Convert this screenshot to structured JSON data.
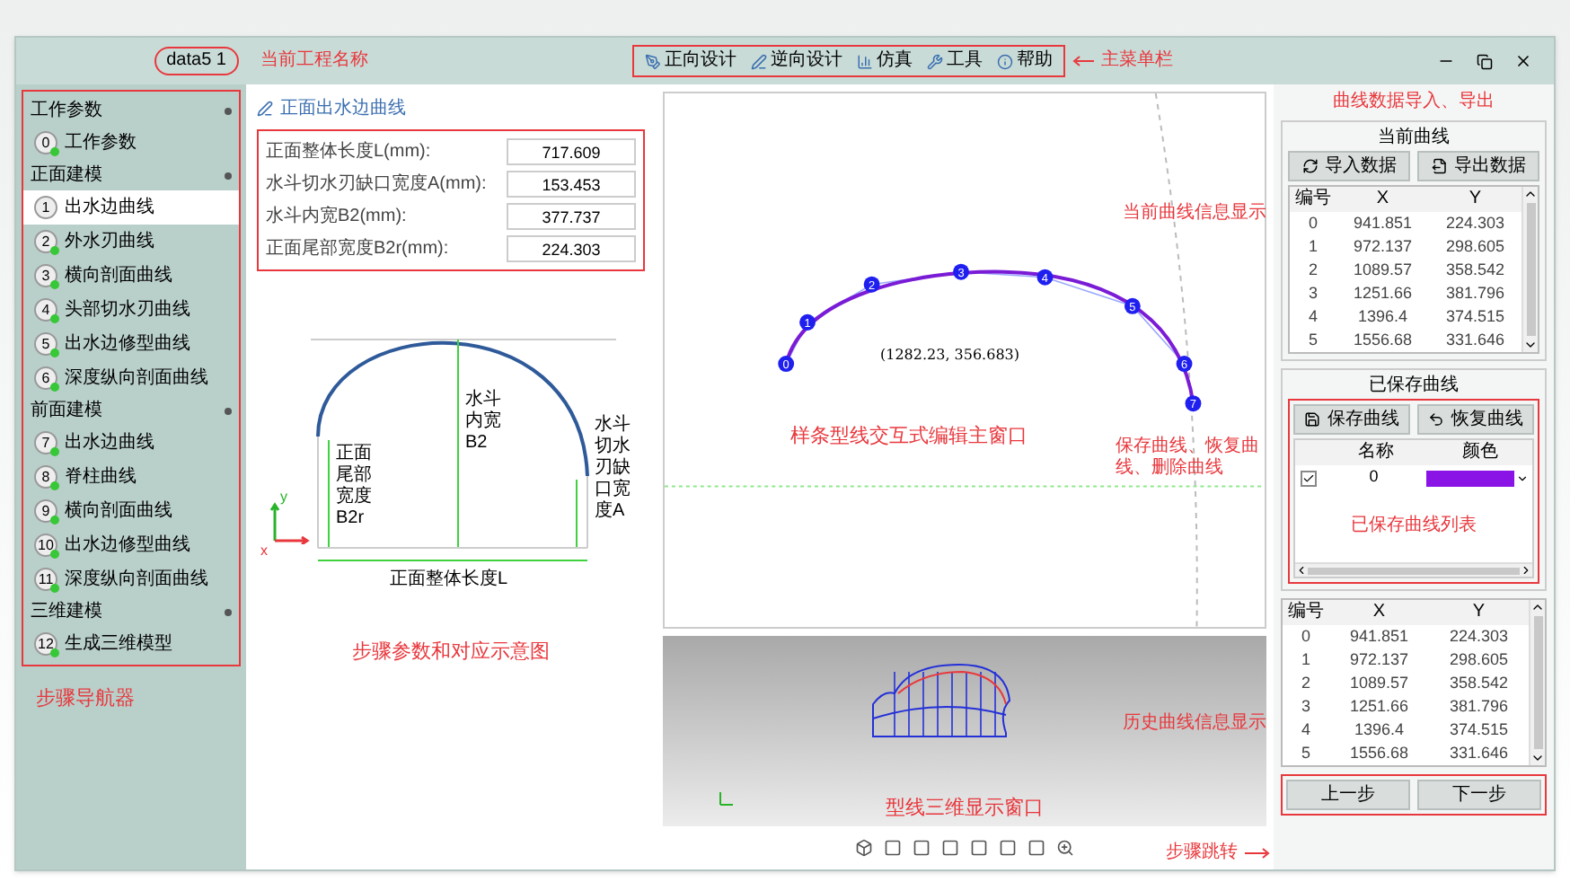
{
  "window": {
    "project_name": "data5 1",
    "project_name_note": "当前工程名称"
  },
  "menu": {
    "items": [
      {
        "label": "正向设计"
      },
      {
        "label": "逆向设计"
      },
      {
        "label": "仿真"
      },
      {
        "label": "工具"
      },
      {
        "label": "帮助"
      }
    ],
    "note": "主菜单栏"
  },
  "navigator": {
    "groups": [
      {
        "title": "工作参数",
        "items": [
          {
            "number": "0",
            "label": "工作参数",
            "selected": false,
            "done": true
          }
        ]
      },
      {
        "title": "正面建模",
        "items": [
          {
            "number": "1",
            "label": "出水边曲线",
            "selected": true,
            "done": false
          },
          {
            "number": "2",
            "label": "外水刃曲线",
            "selected": false,
            "done": true
          },
          {
            "number": "3",
            "label": "横向剖面曲线",
            "selected": false,
            "done": true
          },
          {
            "number": "4",
            "label": "头部切水刃曲线",
            "selected": false,
            "done": true
          },
          {
            "number": "5",
            "label": "出水边修型曲线",
            "selected": false,
            "done": true
          },
          {
            "number": "6",
            "label": "深度纵向剖面曲线",
            "selected": false,
            "done": true
          }
        ]
      },
      {
        "title": "前面建模",
        "items": [
          {
            "number": "7",
            "label": "出水边曲线",
            "selected": false,
            "done": true
          },
          {
            "number": "8",
            "label": "脊柱曲线",
            "selected": false,
            "done": true
          },
          {
            "number": "9",
            "label": "横向剖面曲线",
            "selected": false,
            "done": true
          },
          {
            "number": "10",
            "label": "出水边修型曲线",
            "selected": false,
            "done": true
          },
          {
            "number": "11",
            "label": "深度纵向剖面曲线",
            "selected": false,
            "done": true
          }
        ]
      },
      {
        "title": "三维建模",
        "items": [
          {
            "number": "12",
            "label": "生成三维模型",
            "selected": false,
            "done": true
          }
        ]
      }
    ],
    "note": "步骤导航器"
  },
  "params": {
    "title": "正面出水边曲线",
    "fields": [
      {
        "label": "正面整体长度L(mm):",
        "value": "717.609"
      },
      {
        "label": "水斗切水刃缺口宽度A(mm):",
        "value": "153.453"
      },
      {
        "label": "水斗内宽B2(mm):",
        "value": "377.737"
      },
      {
        "label": "正面尾部宽度B2r(mm):",
        "value": "224.303"
      }
    ],
    "diagram": {
      "tail_width": "正面尾部宽度B2r",
      "inner_width": "水斗内宽B2",
      "notch_width": "水斗切水刃缺口宽度A",
      "length": "正面整体长度L",
      "x_axis": "x",
      "y_axis": "y"
    },
    "note": "步骤参数和对应示意图"
  },
  "editor": {
    "coordinate": "(1282.23, 356.683)",
    "points": [
      "0",
      "1",
      "2",
      "3",
      "4",
      "5",
      "6",
      "7"
    ],
    "note": "样条型线交互式编辑主窗口"
  },
  "viewer": {
    "note": "型线三维显示窗口"
  },
  "current_curve": {
    "note": "曲线数据导入、导出",
    "title": "当前曲线",
    "buttons": [
      "导入数据",
      "导出数据"
    ],
    "columns": [
      "编号",
      "X",
      "Y"
    ],
    "rows": [
      [
        "0",
        "941.851",
        "224.303"
      ],
      [
        "1",
        "972.137",
        "298.605"
      ],
      [
        "2",
        "1089.57",
        "358.542"
      ],
      [
        "3",
        "1251.66",
        "381.796"
      ],
      [
        "4",
        "1396.4",
        "374.515"
      ],
      [
        "5",
        "1556.68",
        "331.646"
      ]
    ],
    "info_note": "当前曲线信息显示"
  },
  "saved_curves": {
    "title": "已保存曲线",
    "buttons": [
      "保存曲线",
      "恢复曲线"
    ],
    "columns": [
      "名称",
      "颜色"
    ],
    "rows": [
      {
        "checked": true,
        "name": "0",
        "color": "#8a14e6"
      }
    ],
    "note": "保存曲线、恢复曲线、删除曲线",
    "list_note": "已保存曲线列表"
  },
  "history": {
    "columns": [
      "编号",
      "X",
      "Y"
    ],
    "rows": [
      [
        "0",
        "941.851",
        "224.303"
      ],
      [
        "1",
        "972.137",
        "298.605"
      ],
      [
        "2",
        "1089.57",
        "358.542"
      ],
      [
        "3",
        "1251.66",
        "381.796"
      ],
      [
        "4",
        "1396.4",
        "374.515"
      ],
      [
        "5",
        "1556.68",
        "331.646"
      ]
    ],
    "note": "历史曲线信息显示"
  },
  "steps": {
    "buttons": [
      "上一步",
      "下一步"
    ],
    "note": "步骤跳转"
  }
}
